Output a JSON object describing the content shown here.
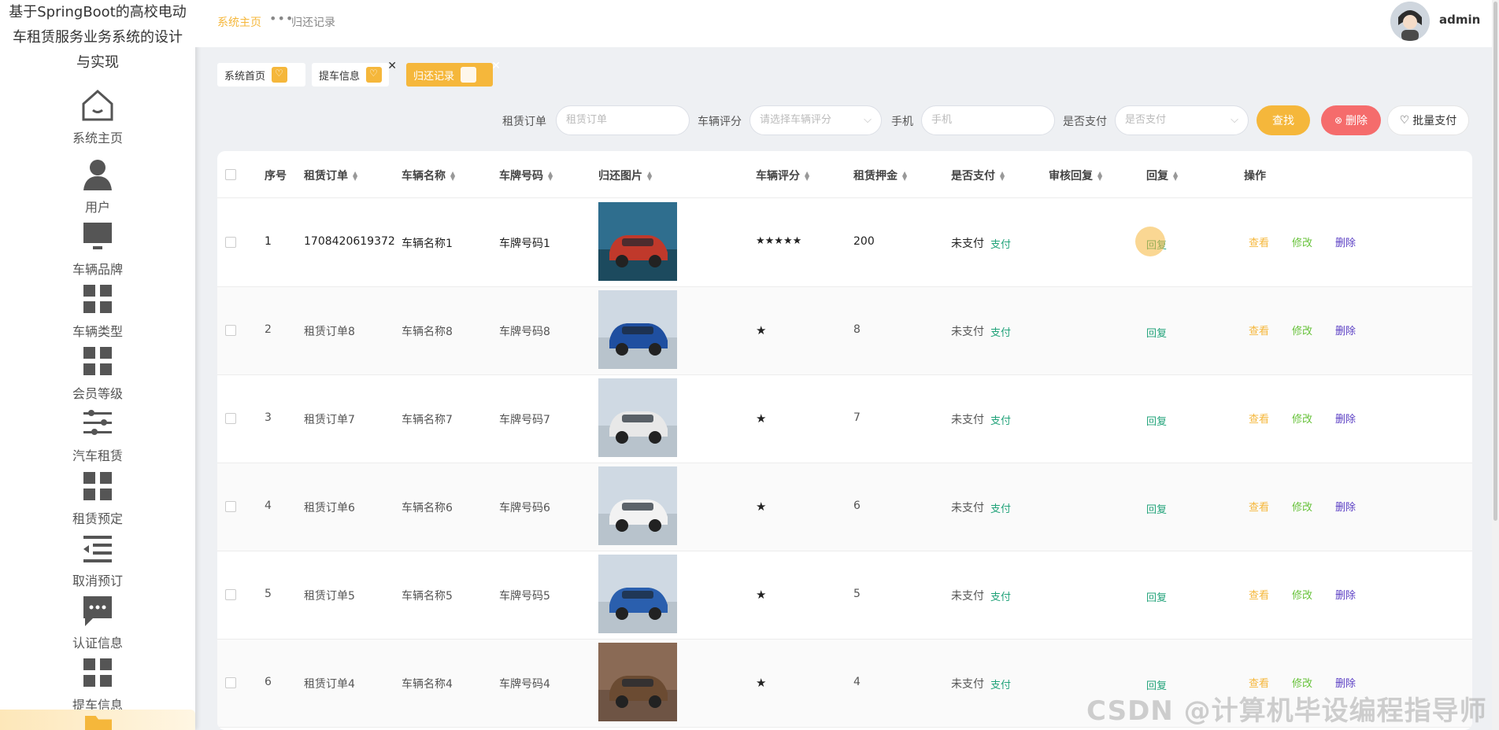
{
  "system_title": "基于SpringBoot的高校电动车租赁服务业务系统的设计与实现",
  "sidebar": {
    "items": [
      {
        "label": "系统主页",
        "icon": "home-icon"
      },
      {
        "label": "用户",
        "icon": "user-icon"
      },
      {
        "label": "车辆品牌",
        "icon": "monitor-icon"
      },
      {
        "label": "车辆类型",
        "icon": "grid-icon"
      },
      {
        "label": "会员等级",
        "icon": "grid-icon"
      },
      {
        "label": "汽车租赁",
        "icon": "sliders-icon"
      },
      {
        "label": "租赁预定",
        "icon": "grid-icon"
      },
      {
        "label": "取消预订",
        "icon": "list-indent-icon"
      },
      {
        "label": "认证信息",
        "icon": "chat-icon"
      },
      {
        "label": "提车信息",
        "icon": "grid-icon"
      }
    ]
  },
  "topbar": {
    "breadcrumb_home": "系统主页",
    "breadcrumb_current": "归还记录",
    "username": "admin"
  },
  "tabs": [
    {
      "label": "系统首页",
      "closable": false,
      "active": false
    },
    {
      "label": "提车信息",
      "closable": true,
      "active": false
    },
    {
      "label": "归还记录",
      "closable": true,
      "active": true
    }
  ],
  "filters": {
    "order_label": "租赁订单",
    "order_placeholder": "租赁订单",
    "rating_label": "车辆评分",
    "rating_placeholder": "请选择车辆评分",
    "phone_label": "手机",
    "phone_placeholder": "手机",
    "paid_label": "是否支付",
    "paid_placeholder": "是否支付",
    "search_button": "查找",
    "delete_button": "删除",
    "batch_pay_button": "批量支付"
  },
  "table": {
    "columns": [
      "序号",
      "租赁订单",
      "车辆名称",
      "车牌号码",
      "归还图片",
      "车辆评分",
      "租赁押金",
      "是否支付",
      "审核回复",
      "回复",
      "操作"
    ],
    "rows": [
      {
        "index": "1",
        "order": "1708420619372",
        "name": "车辆名称1",
        "plate": "车牌号码1",
        "rating": "★★★★★",
        "deposit": "200",
        "paid": "未支付",
        "pay_link": "支付",
        "reply": "回复",
        "car_color": "#c0392b"
      },
      {
        "index": "2",
        "order": "租赁订单8",
        "name": "车辆名称8",
        "plate": "车牌号码8",
        "rating": "★",
        "deposit": "8",
        "paid": "未支付",
        "pay_link": "支付",
        "reply": "回复",
        "car_color": "#1f4fa0"
      },
      {
        "index": "3",
        "order": "租赁订单7",
        "name": "车辆名称7",
        "plate": "车牌号码7",
        "rating": "★",
        "deposit": "7",
        "paid": "未支付",
        "pay_link": "支付",
        "reply": "回复",
        "car_color": "#e8e8e8"
      },
      {
        "index": "4",
        "order": "租赁订单6",
        "name": "车辆名称6",
        "plate": "车牌号码6",
        "rating": "★",
        "deposit": "6",
        "paid": "未支付",
        "pay_link": "支付",
        "reply": "回复",
        "car_color": "#f2f2f2"
      },
      {
        "index": "5",
        "order": "租赁订单5",
        "name": "车辆名称5",
        "plate": "车牌号码5",
        "rating": "★",
        "deposit": "5",
        "paid": "未支付",
        "pay_link": "支付",
        "reply": "回复",
        "car_color": "#2a5fae"
      },
      {
        "index": "6",
        "order": "租赁订单4",
        "name": "车辆名称4",
        "plate": "车牌号码4",
        "rating": "★",
        "deposit": "4",
        "paid": "未支付",
        "pay_link": "支付",
        "reply": "回复",
        "car_color": "#6b4b32"
      }
    ],
    "actions": {
      "view": "查看",
      "edit": "修改",
      "delete": "删除"
    }
  },
  "watermark": "CSDN @计算机毕设编程指导师",
  "colors": {
    "accent": "#f5b73b",
    "danger": "#f56c6c",
    "green": "#22a37a",
    "purple": "#5b3fc4",
    "view": "#f5b73b",
    "edit": "#67c23a"
  }
}
